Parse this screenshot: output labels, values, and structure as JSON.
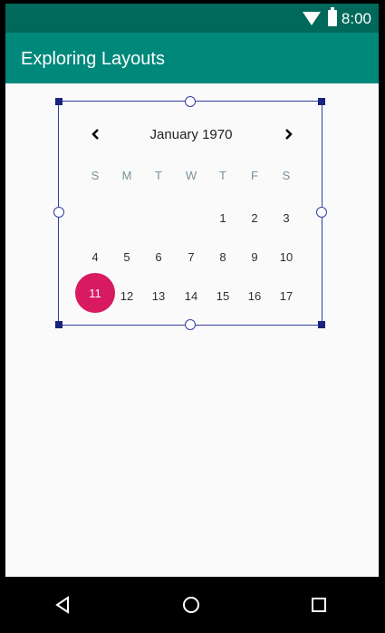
{
  "status_bar": {
    "time": "8:00",
    "icons": [
      "wifi-icon",
      "battery-icon"
    ]
  },
  "app_bar": {
    "title": "Exploring Layouts",
    "color": "#00897b"
  },
  "calendar": {
    "month_year": "January 1970",
    "weekdays": [
      "S",
      "M",
      "T",
      "W",
      "T",
      "F",
      "S"
    ],
    "week1": [
      "1",
      "2",
      "3"
    ],
    "week2": [
      "4",
      "5",
      "6",
      "7",
      "8",
      "9",
      "10"
    ],
    "week3_selected": "11",
    "week3": [
      "12",
      "13",
      "14",
      "15",
      "16",
      "17"
    ],
    "selected_color": "#d81b60",
    "prev_icon": "chevron-left-icon",
    "next_icon": "chevron-right-icon"
  },
  "system_nav": {
    "buttons": [
      "back-icon",
      "home-icon",
      "recents-icon"
    ]
  }
}
